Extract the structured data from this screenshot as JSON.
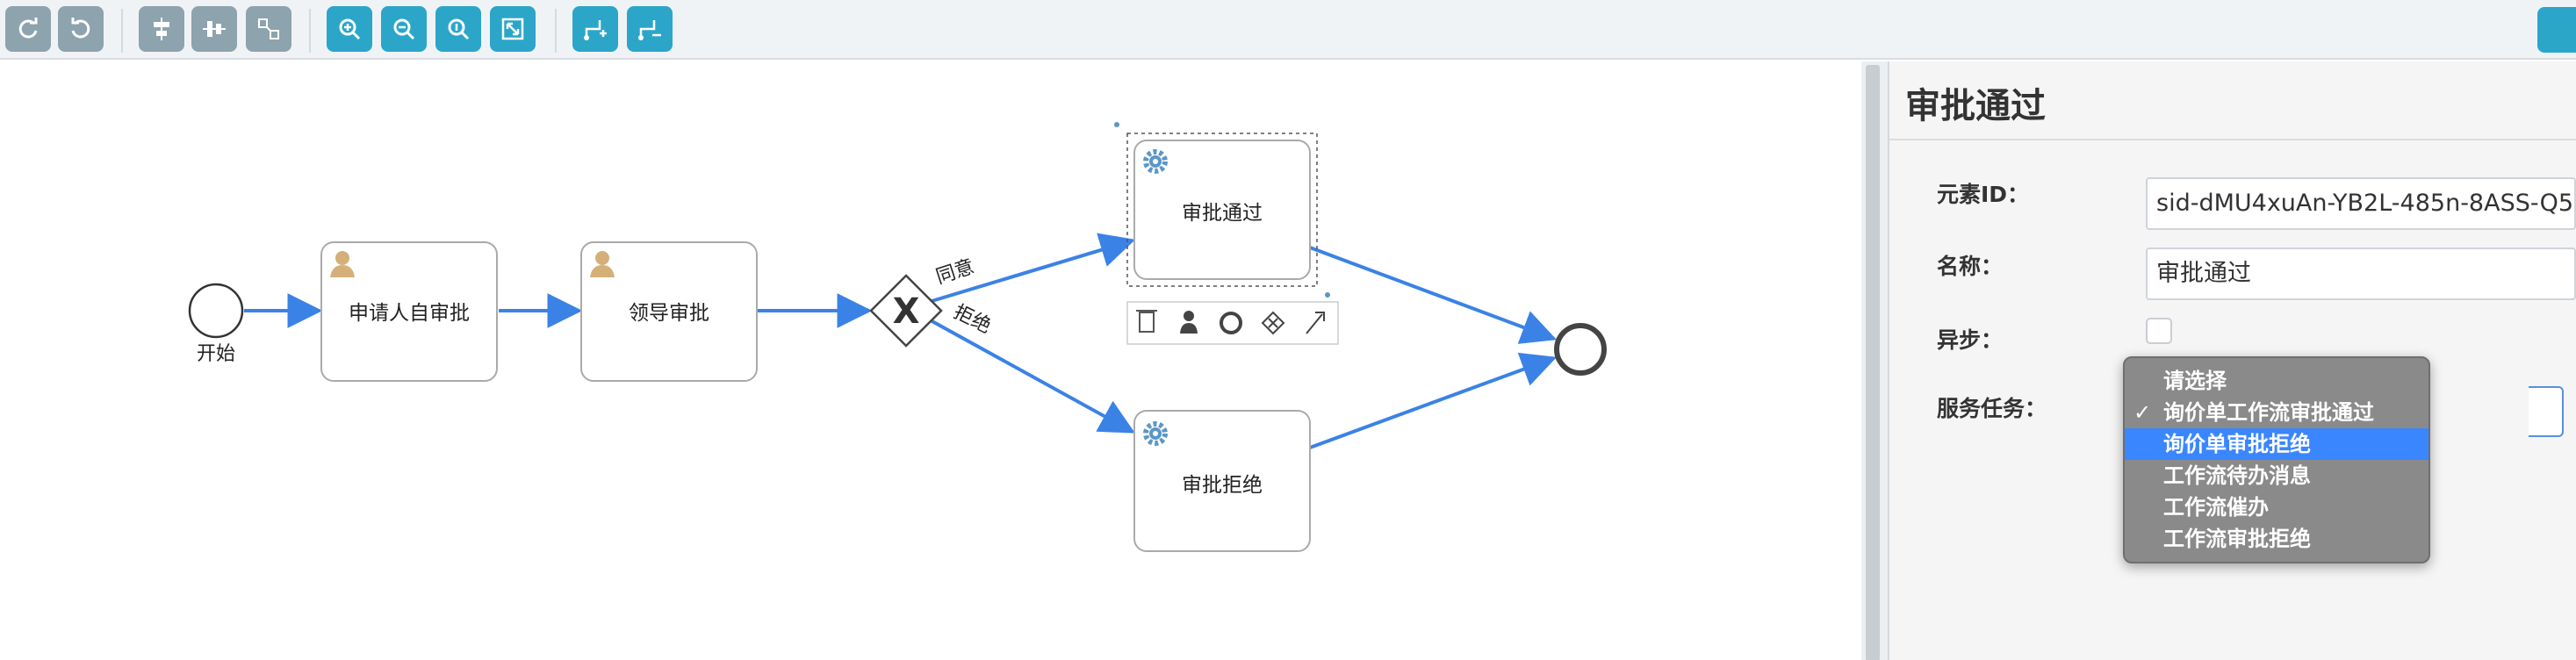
{
  "canvas": {
    "nodes": {
      "start_label": "开始",
      "applicant_task": "申请人自审批",
      "leader_task": "领导审批",
      "approve_task": "审批通过",
      "reject_task": "审批拒绝",
      "gateway_symbol": "X"
    },
    "flows": {
      "agree_label": "同意",
      "reject_label": "拒绝"
    }
  },
  "panel": {
    "title": "审批通过",
    "element_id_label": "元素ID：",
    "element_id_value": "sid-dMU4xuAn-YB2L-485n-8ASS-Q5",
    "name_label": "名称：",
    "name_value": "审批通过",
    "async_label": "异步：",
    "service_task_label": "服务任务："
  },
  "dropdown": {
    "options": [
      {
        "label": "请选择",
        "checked": false,
        "highlighted": false
      },
      {
        "label": "询价单工作流审批通过",
        "checked": true,
        "highlighted": false
      },
      {
        "label": "询价单审批拒绝",
        "checked": false,
        "highlighted": true
      },
      {
        "label": "工作流待办消息",
        "checked": false,
        "highlighted": false
      },
      {
        "label": "工作流催办",
        "checked": false,
        "highlighted": false
      },
      {
        "label": "工作流审批拒绝",
        "checked": false,
        "highlighted": false
      }
    ],
    "check_mark": "✓"
  },
  "colors": {
    "toolbar_grey": "#8da3ad",
    "toolbar_teal": "#2ba6c9",
    "flow_line": "#3b82e6",
    "selection_blue": "#3a86ff"
  }
}
